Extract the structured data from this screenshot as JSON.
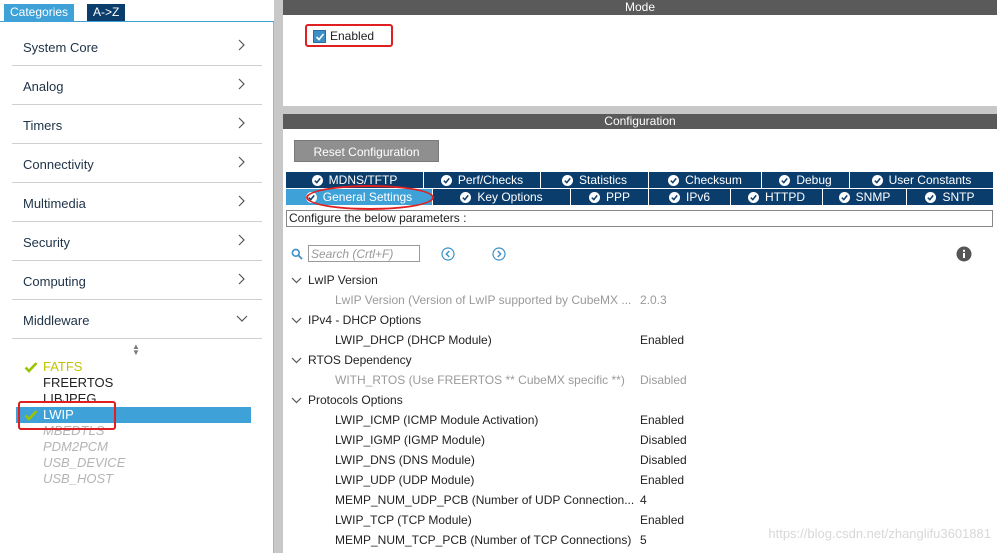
{
  "left_tabs": {
    "categories": "Categories",
    "az": "A->Z"
  },
  "categories": [
    {
      "label": "System Core"
    },
    {
      "label": "Analog"
    },
    {
      "label": "Timers"
    },
    {
      "label": "Connectivity"
    },
    {
      "label": "Multimedia"
    },
    {
      "label": "Security"
    },
    {
      "label": "Computing"
    },
    {
      "label": "Middleware"
    }
  ],
  "middleware_items": [
    {
      "label": "FATFS",
      "state": "active",
      "checked": true
    },
    {
      "label": "FREERTOS",
      "state": "normal",
      "checked": false
    },
    {
      "label": "LIBJPEG",
      "state": "normal",
      "checked": false
    },
    {
      "label": "LWIP",
      "state": "selected",
      "checked": true
    },
    {
      "label": "MBEDTLS",
      "state": "disabled",
      "checked": false
    },
    {
      "label": "PDM2PCM",
      "state": "disabled",
      "checked": false
    },
    {
      "label": "USB_DEVICE",
      "state": "disabled",
      "checked": false
    },
    {
      "label": "USB_HOST",
      "state": "disabled",
      "checked": false
    }
  ],
  "mode": {
    "header": "Mode",
    "enabled_label": "Enabled",
    "enabled_checked": true
  },
  "config": {
    "header": "Configuration",
    "reset_label": "Reset Configuration",
    "tabs_row1": [
      "MDNS/TFTP",
      "Perf/Checks",
      "Statistics",
      "Checksum",
      "Debug",
      "User Constants"
    ],
    "tabs_row2": [
      "General Settings",
      "Key Options",
      "PPP",
      "IPv6",
      "HTTPD",
      "SNMP",
      "SNTP"
    ],
    "active_tab": "General Settings",
    "description": "Configure the below parameters :",
    "search_placeholder": "Search (Crtl+F)"
  },
  "groups": [
    {
      "label": "LwIP Version",
      "params": [
        {
          "name": "LwIP Version (Version of LwIP supported by CubeMX ...",
          "value": "2.0.3",
          "dim": true
        }
      ]
    },
    {
      "label": "IPv4 - DHCP Options",
      "params": [
        {
          "name": "LWIP_DHCP (DHCP Module)",
          "value": "Enabled",
          "dim": false
        }
      ]
    },
    {
      "label": "RTOS Dependency",
      "params": [
        {
          "name": "WITH_RTOS (Use FREERTOS ** CubeMX specific **)",
          "value": "Disabled",
          "dim": true
        }
      ]
    },
    {
      "label": "Protocols Options",
      "params": [
        {
          "name": "LWIP_ICMP (ICMP Module Activation)",
          "value": "Enabled",
          "dim": false
        },
        {
          "name": "LWIP_IGMP (IGMP Module)",
          "value": "Disabled",
          "dim": false
        },
        {
          "name": "LWIP_DNS (DNS Module)",
          "value": "Disabled",
          "dim": false
        },
        {
          "name": "LWIP_UDP (UDP Module)",
          "value": "Enabled",
          "dim": false
        },
        {
          "name": "MEMP_NUM_UDP_PCB (Number of UDP Connection...",
          "value": "4",
          "dim": false
        },
        {
          "name": "LWIP_TCP (TCP Module)",
          "value": "Enabled",
          "dim": false
        },
        {
          "name": "MEMP_NUM_TCP_PCB (Number of TCP Connections)",
          "value": "5",
          "dim": false
        }
      ]
    }
  ],
  "watermark": "https://blog.csdn.net/zhanglifu3601881",
  "colors": {
    "accent": "#3ea2d8",
    "navy": "#0b3d6c",
    "highlight": "#e02020",
    "active_item": "#c2c200"
  }
}
